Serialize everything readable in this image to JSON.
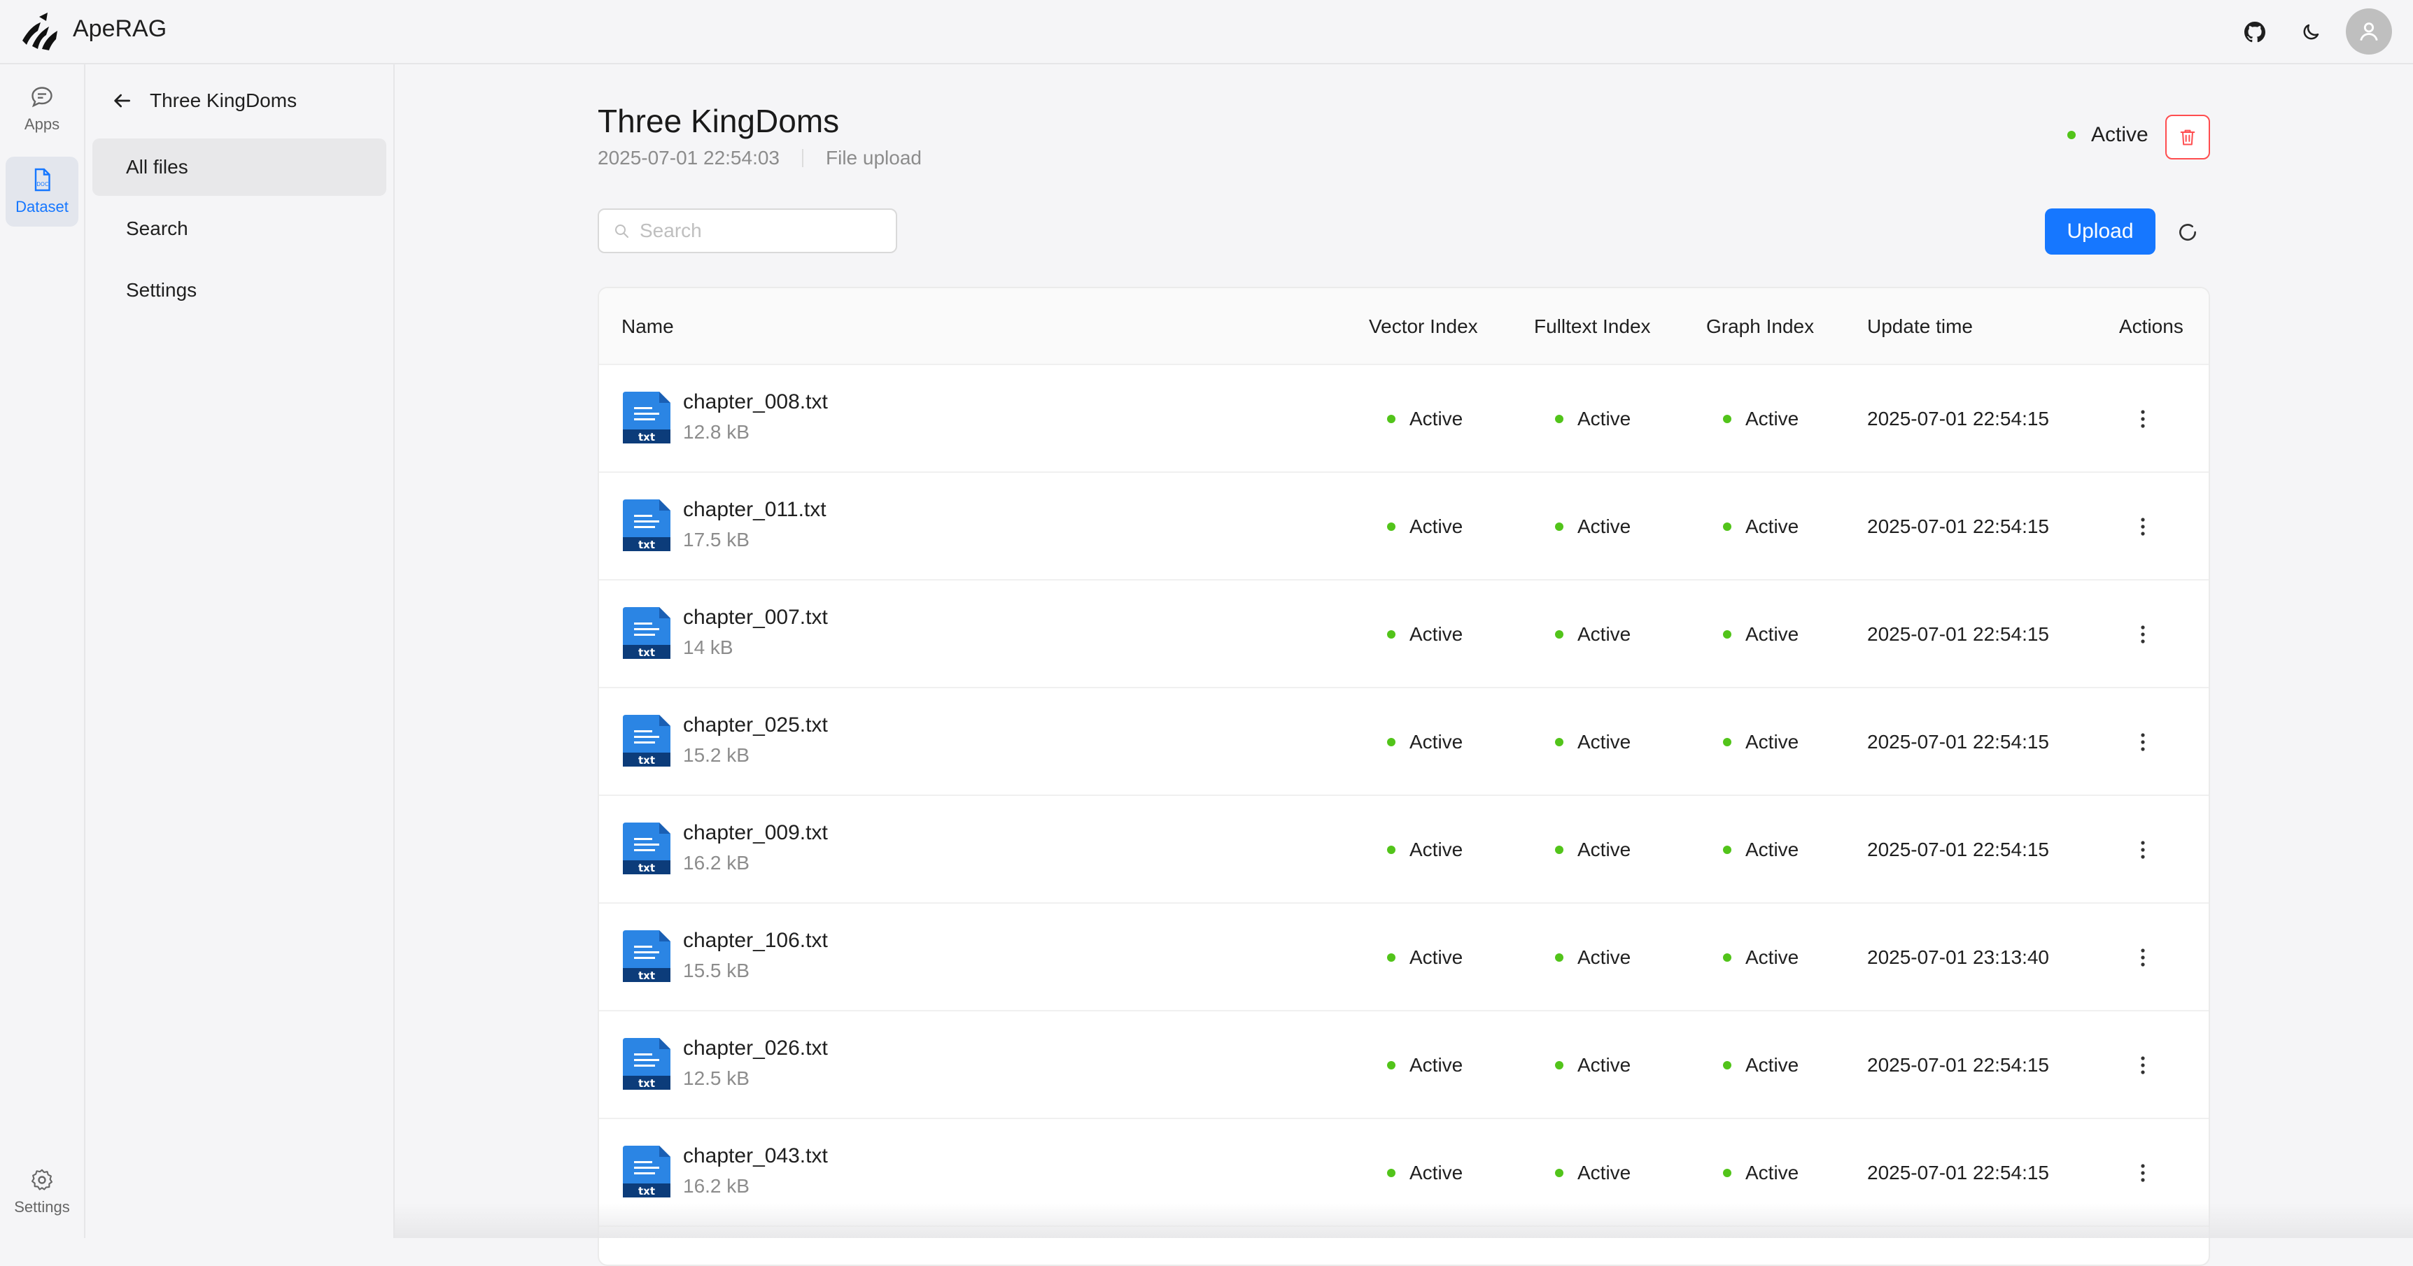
{
  "app": {
    "name": "ApeRAG"
  },
  "rail": {
    "apps_label": "Apps",
    "dataset_label": "Dataset",
    "settings_label": "Settings"
  },
  "subnav": {
    "title": "Three KingDoms",
    "items": [
      {
        "label": "All files"
      },
      {
        "label": "Search"
      },
      {
        "label": "Settings"
      }
    ]
  },
  "dataset": {
    "title": "Three KingDoms",
    "created": "2025-07-01 22:54:03",
    "source": "File upload",
    "status": "Active",
    "status_color": "#52c41a"
  },
  "toolbar": {
    "search_placeholder": "Search",
    "upload_label": "Upload"
  },
  "table": {
    "columns": {
      "name": "Name",
      "vector": "Vector Index",
      "fulltext": "Fulltext Index",
      "graph": "Graph Index",
      "updated": "Update time",
      "actions": "Actions"
    },
    "rows": [
      {
        "icon_text": "txt",
        "name": "chapter_008.txt",
        "size": "12.8 kB",
        "vector": "Active",
        "fulltext": "Active",
        "graph": "Active",
        "updated": "2025-07-01 22:54:15"
      },
      {
        "icon_text": "txt",
        "name": "chapter_011.txt",
        "size": "17.5 kB",
        "vector": "Active",
        "fulltext": "Active",
        "graph": "Active",
        "updated": "2025-07-01 22:54:15"
      },
      {
        "icon_text": "txt",
        "name": "chapter_007.txt",
        "size": "14 kB",
        "vector": "Active",
        "fulltext": "Active",
        "graph": "Active",
        "updated": "2025-07-01 22:54:15"
      },
      {
        "icon_text": "txt",
        "name": "chapter_025.txt",
        "size": "15.2 kB",
        "vector": "Active",
        "fulltext": "Active",
        "graph": "Active",
        "updated": "2025-07-01 22:54:15"
      },
      {
        "icon_text": "txt",
        "name": "chapter_009.txt",
        "size": "16.2 kB",
        "vector": "Active",
        "fulltext": "Active",
        "graph": "Active",
        "updated": "2025-07-01 22:54:15"
      },
      {
        "icon_text": "txt",
        "name": "chapter_106.txt",
        "size": "15.5 kB",
        "vector": "Active",
        "fulltext": "Active",
        "graph": "Active",
        "updated": "2025-07-01 23:13:40"
      },
      {
        "icon_text": "txt",
        "name": "chapter_026.txt",
        "size": "12.5 kB",
        "vector": "Active",
        "fulltext": "Active",
        "graph": "Active",
        "updated": "2025-07-01 22:54:15"
      },
      {
        "icon_text": "txt",
        "name": "chapter_043.txt",
        "size": "16.2 kB",
        "vector": "Active",
        "fulltext": "Active",
        "graph": "Active",
        "updated": "2025-07-01 22:54:15"
      }
    ]
  },
  "colors": {
    "primary": "#1677ff",
    "danger": "#ff4d4f",
    "active_dot": "#52c41a"
  }
}
